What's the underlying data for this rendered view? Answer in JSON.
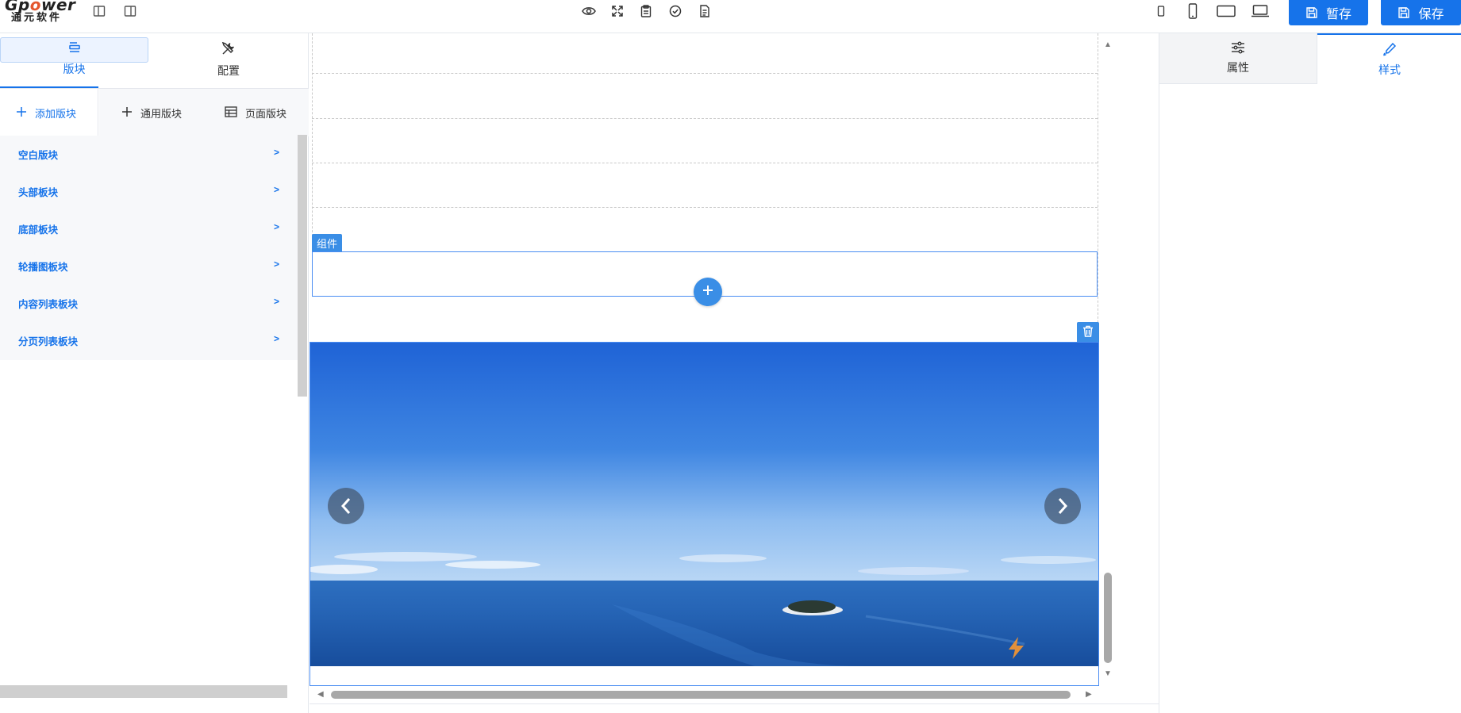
{
  "header": {
    "logo": {
      "brand_prefix": "Gp",
      "brand_o": "o",
      "brand_suffix": "wer",
      "cn": "通元软件"
    },
    "left_icons": [
      "panel-left-icon",
      "panel-right-icon"
    ],
    "center_icons": [
      "eye-preview-icon",
      "fullscreen-icon",
      "clipboard-icon",
      "check-circle-icon",
      "document-icon"
    ],
    "device_icons": [
      "mobile-small-icon",
      "mobile-icon",
      "tablet-icon",
      "laptop-icon"
    ],
    "draft_save_label": "暂存",
    "save_label": "保存",
    "accent": "#1673ea"
  },
  "left_panel": {
    "tabs": [
      {
        "label": "版块",
        "icon": "blocks-icon",
        "active": true
      },
      {
        "label": "配置",
        "icon": "tools-icon",
        "active": false
      }
    ],
    "subtabs": [
      {
        "label": "添加版块",
        "icon": "plus-icon",
        "active": true
      },
      {
        "label": "通用版块",
        "icon": "plus-icon",
        "active": false
      },
      {
        "label": "页面版块",
        "icon": "table-icon",
        "active": false
      }
    ],
    "items": [
      {
        "label": "空白版块"
      },
      {
        "label": "头部板块"
      },
      {
        "label": "底部板块"
      },
      {
        "label": "轮播图板块"
      },
      {
        "label": "内容列表板块"
      },
      {
        "label": "分页列表板块"
      }
    ]
  },
  "canvas": {
    "component_tag": "组件",
    "add_icon": "plus-circle-icon",
    "delete_icon": "trash-icon",
    "carousel": {
      "prev_icon": "chevron-left-icon",
      "next_icon": "chevron-right-icon",
      "badge_icon": "lightning-icon"
    }
  },
  "right_panel": {
    "tabs": [
      {
        "label": "属性",
        "icon": "sliders-icon",
        "active": false
      },
      {
        "label": "样式",
        "icon": "brush-icon",
        "active": true
      }
    ]
  }
}
